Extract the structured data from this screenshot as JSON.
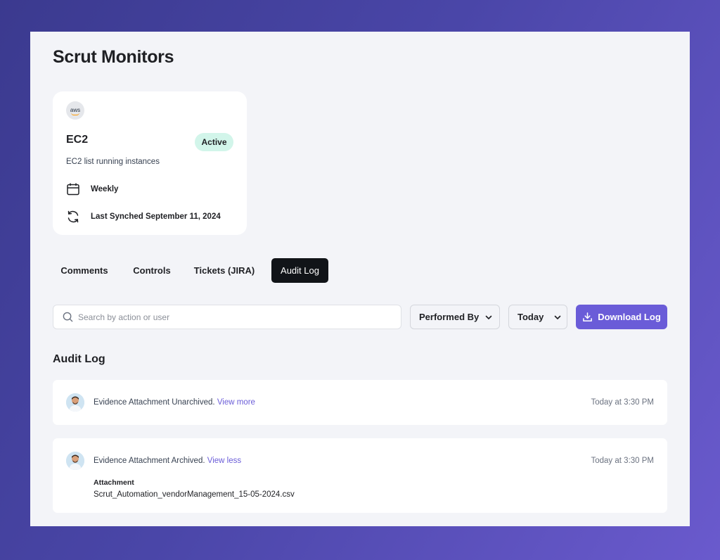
{
  "page": {
    "title": "Scrut Monitors"
  },
  "monitor": {
    "logo_text": "aws",
    "name": "EC2",
    "status": "Active",
    "description": "EC2 list running instances",
    "frequency": "Weekly",
    "last_synced": "Last Synched September 11, 2024"
  },
  "tabs": [
    {
      "label": "Comments",
      "active": false
    },
    {
      "label": "Controls",
      "active": false
    },
    {
      "label": "Tickets (JIRA)",
      "active": false
    },
    {
      "label": "Audit Log",
      "active": true
    }
  ],
  "toolbar": {
    "search_placeholder": "Search by action or user",
    "performed_by_label": "Performed By",
    "date_filter_label": "Today",
    "download_label": "Download Log"
  },
  "audit_log": {
    "title": "Audit Log",
    "entries": [
      {
        "text": "Evidence Attachment Unarchived.",
        "link": "View more",
        "time": "Today at 3:30 PM"
      },
      {
        "text": "Evidence Attachment Archived.",
        "link": "View less",
        "time": "Today at 3:30 PM",
        "attachment_label": "Attachment",
        "attachment_file": "Scrut_Automation_vendorManagement_15-05-2024.csv"
      }
    ]
  },
  "colors": {
    "accent": "#6a5cd8",
    "active_badge_bg": "#d2f5ea",
    "active_tab_bg": "#111418"
  },
  "icons": [
    "aws-logo",
    "calendar-icon",
    "sync-icon",
    "search-icon",
    "chevron-down-icon",
    "download-icon",
    "user-avatar"
  ]
}
